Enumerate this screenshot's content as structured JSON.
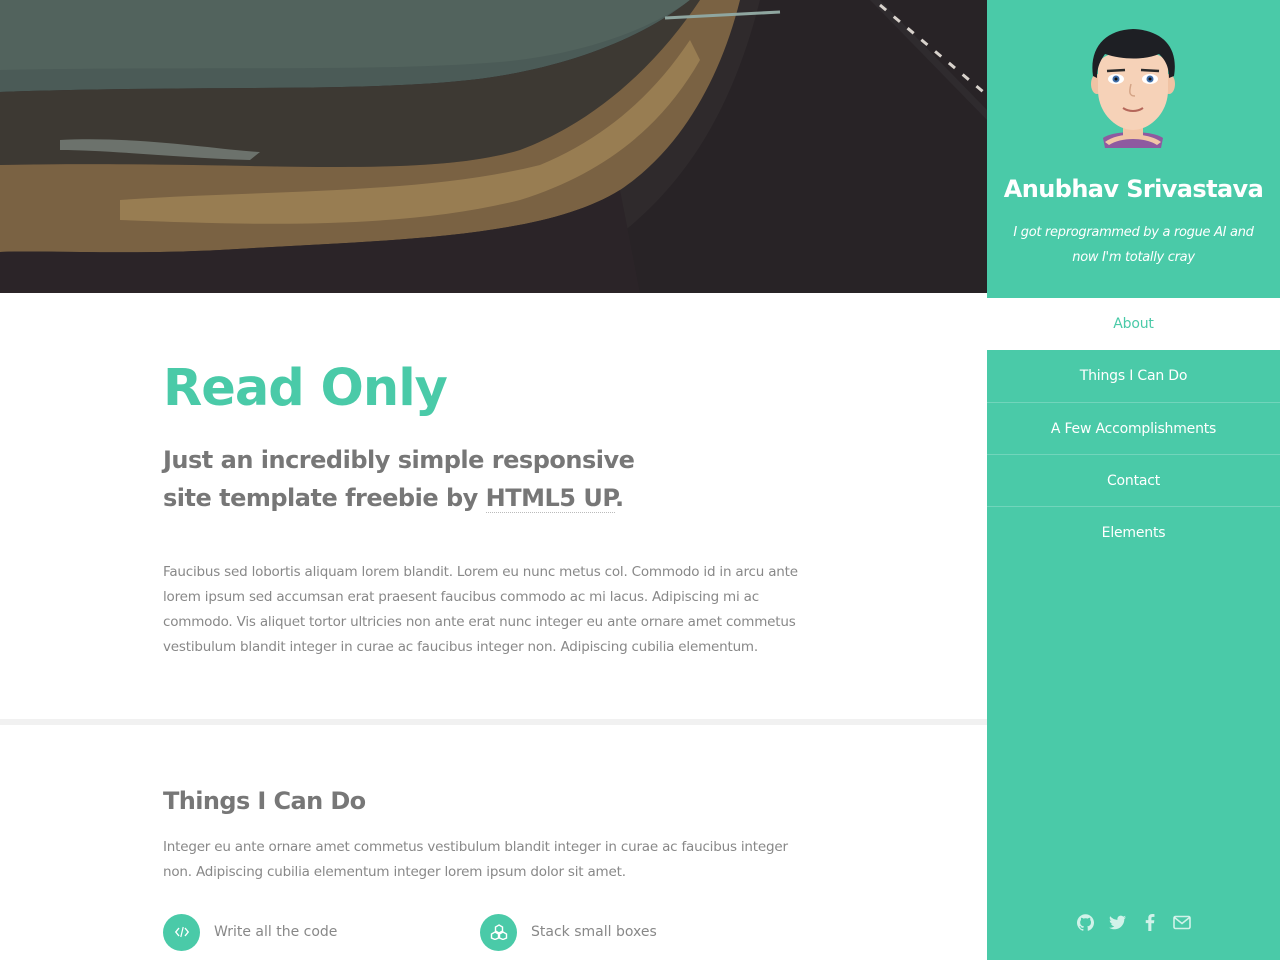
{
  "main": {
    "title": "Read Only",
    "subtitle_text": "Just an incredibly simple responsive site template freebie by ",
    "subtitle_link": "HTML5 UP",
    "subtitle_end": ".",
    "body": "Faucibus sed lobortis aliquam lorem blandit. Lorem eu nunc metus col. Commodo id in arcu ante lorem ipsum sed accumsan erat praesent faucibus commodo ac mi lacus. Adipiscing mi ac commodo. Vis aliquet tortor ultricies non ante erat nunc integer eu ante ornare amet commetus vestibulum blandit integer in curae ac faucibus integer non. Adipiscing cubilia elementum."
  },
  "skills": {
    "heading": "Things I Can Do",
    "intro": "Integer eu ante ornare amet commetus vestibulum blandit integer in curae ac faucibus integer non. Adipiscing cubilia elementum integer lorem ipsum dolor sit amet.",
    "features": [
      {
        "label": "Write all the code",
        "icon": "code-icon"
      },
      {
        "label": "Stack small boxes",
        "icon": "cubes-icon"
      }
    ]
  },
  "sidebar": {
    "name": "Anubhav Srivastava",
    "tagline": "I got reprogrammed by a rogue AI and now I'm totally cray",
    "nav": [
      {
        "label": "About",
        "active": true
      },
      {
        "label": "Things I Can Do",
        "active": false
      },
      {
        "label": "A Few Accomplishments",
        "active": false
      },
      {
        "label": "Contact",
        "active": false
      },
      {
        "label": "Elements",
        "active": false
      }
    ],
    "social": [
      "github-icon",
      "twitter-icon",
      "facebook-icon",
      "envelope-icon"
    ]
  },
  "colors": {
    "accent": "#4acaa8",
    "text": "#888888",
    "heading": "#777777"
  }
}
